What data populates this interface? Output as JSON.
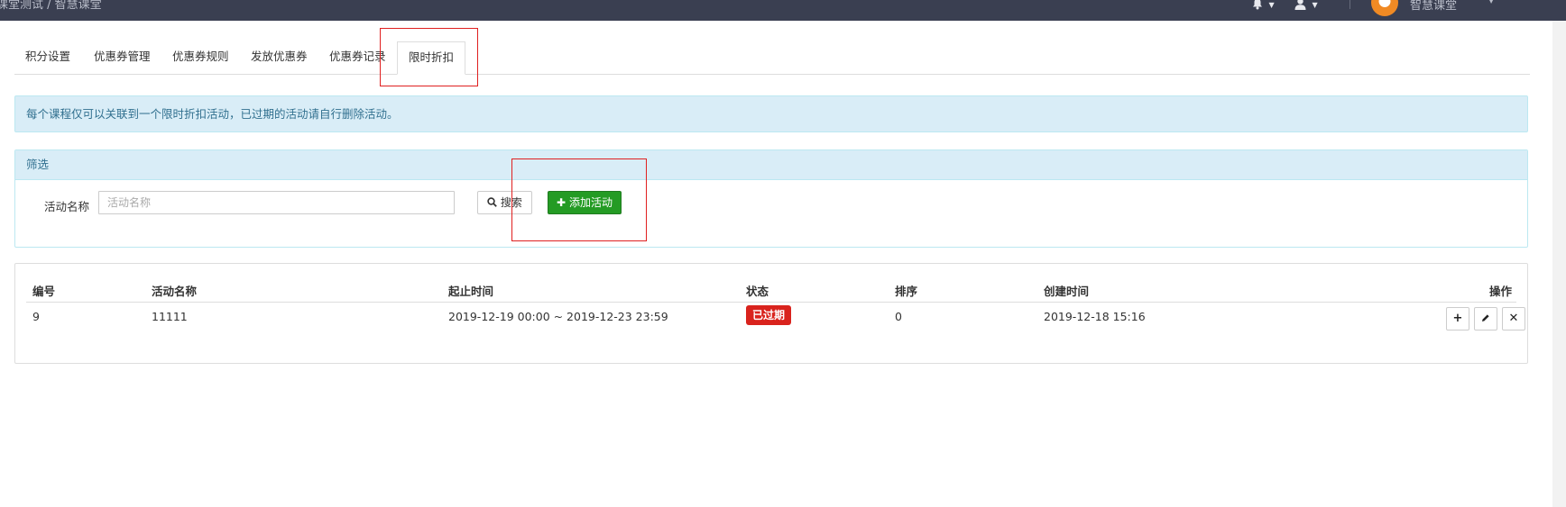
{
  "topbar": {
    "breadcrumb": "课堂测试 / 智慧课堂",
    "user_name": "智慧课堂",
    "icons": [
      "bell-icon",
      "user-icon",
      "avatar"
    ]
  },
  "tabs": [
    {
      "label": "积分设置"
    },
    {
      "label": "优惠券管理"
    },
    {
      "label": "优惠券规则"
    },
    {
      "label": "发放优惠券"
    },
    {
      "label": "优惠券记录"
    },
    {
      "label": "限时折扣",
      "active": true
    }
  ],
  "alert": {
    "text": "每个课程仅可以关联到一个限时折扣活动，已过期的活动请自行删除活动。"
  },
  "filter": {
    "title": "筛选",
    "name_label": "活动名称",
    "name_placeholder": "活动名称",
    "name_value": "",
    "search_label": "搜索",
    "add_label": "添加活动"
  },
  "table": {
    "headers": [
      "编号",
      "活动名称",
      "起止时间",
      "状态",
      "排序",
      "创建时间",
      "操作"
    ],
    "rows": [
      {
        "id": "9",
        "name": "11111",
        "period": "2019-12-19 00:00 ~ 2019-12-23 23:59",
        "status": "已过期",
        "sort": "0",
        "created": "2019-12-18 15:16"
      }
    ]
  },
  "colors": {
    "topbar": "#3a3f51",
    "info_bg": "#d9edf7",
    "add_button": "#249b24",
    "expired_badge": "#d9231d",
    "highlight": "#e02020"
  }
}
